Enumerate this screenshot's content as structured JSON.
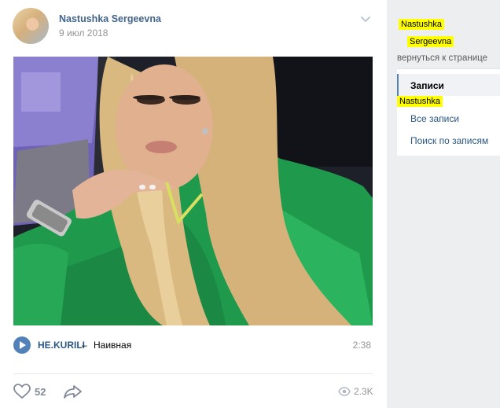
{
  "post": {
    "author": "Nastushka Sergeevna",
    "date": "9 июл 2018",
    "audio": {
      "artist": "HE.KURILI",
      "separator": "–",
      "title": "Наивная",
      "duration": "2:38"
    },
    "likes": "52",
    "views": "2.3K"
  },
  "sidebar": {
    "highlight_name_1": "Nastushka",
    "highlight_name_2": "Sergeevna",
    "back_link": "вернуться к странице",
    "tab_posts": "Записи",
    "highlight_name_3": "Nastushka",
    "all_posts": "Все записи",
    "search_posts": "Поиск по записям"
  },
  "colors": {
    "accent": "#5181b8",
    "link": "#2a5885",
    "highlight": "#ffff00"
  },
  "icons": [
    "chevron-down-icon",
    "play-icon",
    "heart-icon",
    "share-icon",
    "eye-icon"
  ]
}
